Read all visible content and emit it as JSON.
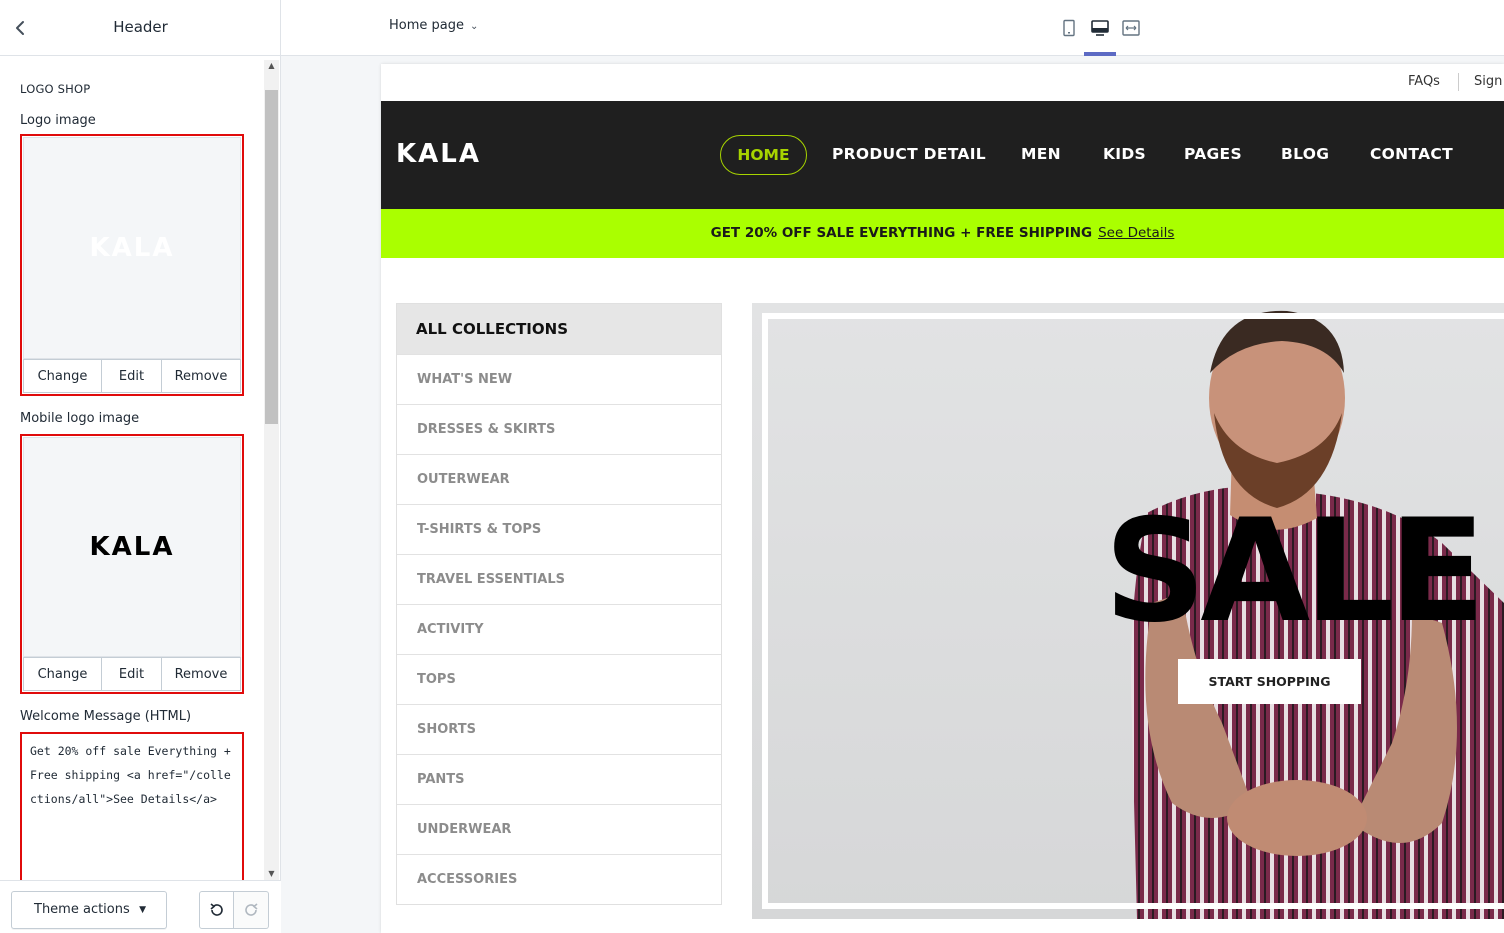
{
  "sidebar": {
    "title": "Header",
    "section_title": "LOGO SHOP",
    "logo_image": {
      "label": "Logo image",
      "logo_text": "KALA",
      "actions": [
        "Change",
        "Edit",
        "Remove"
      ]
    },
    "mobile_logo_image": {
      "label": "Mobile logo image",
      "logo_text": "KALA",
      "actions": [
        "Change",
        "Edit",
        "Remove"
      ]
    },
    "welcome": {
      "label": "Welcome Message (HTML)",
      "value": "Get 20% off sale Everything + Free shipping <a href=\"/collections/all\">See Details</a>"
    },
    "footer": {
      "theme_actions_label": "Theme actions"
    }
  },
  "topbar": {
    "page_select": "Home page",
    "devices": [
      "mobile-icon",
      "desktop-icon",
      "fullwidth-icon"
    ],
    "active_device": "desktop-icon",
    "accent_color": "#5c6ac4"
  },
  "preview": {
    "top_links": [
      "FAQs",
      "Sign"
    ],
    "logo": "KALA",
    "nav": [
      "HOME",
      "PRODUCT DETAIL",
      "MEN",
      "KIDS",
      "PAGES",
      "BLOG",
      "CONTACT"
    ],
    "nav_active": "HOME",
    "nav_accent": "#a7d400",
    "promo": {
      "text": "GET 20% OFF SALE EVERYTHING + FREE SHIPPING",
      "link": "See Details",
      "bg": "#aaff00"
    },
    "collections": {
      "title": "ALL COLLECTIONS",
      "items": [
        "WHAT'S NEW",
        "DRESSES & SKIRTS",
        "OUTERWEAR",
        "T-SHIRTS & TOPS",
        "TRAVEL ESSENTIALS",
        "ACTIVITY",
        "TOPS",
        "SHORTS",
        "PANTS",
        "UNDERWEAR",
        "ACCESSORIES"
      ]
    },
    "hero": {
      "headline": "SALE",
      "button": "START SHOPPING"
    }
  }
}
